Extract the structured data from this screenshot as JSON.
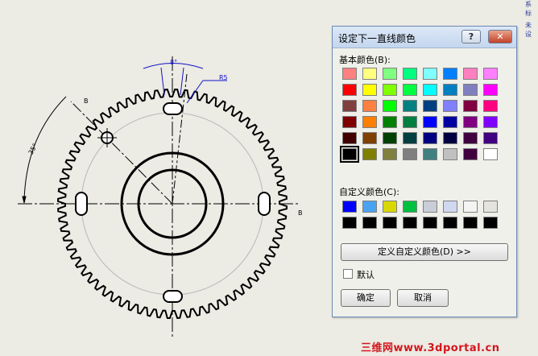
{
  "drawing": {
    "dim_top": "8°",
    "dim_left": "35°",
    "label_b_upper": "B",
    "label_b_right": "B",
    "label_r5": "R5"
  },
  "corner": {
    "line1": "系 标",
    "line2": "未 设"
  },
  "dialog": {
    "title": "设定下一直线颜色",
    "help_label": "?",
    "close_label": "✕",
    "basic_label": "基本颜色(B):",
    "custom_label": "自定义颜色(C):",
    "define_custom_label": "定义自定义颜色(D) >>",
    "default_label": "默认",
    "ok_label": "确定",
    "cancel_label": "取消",
    "default_checked": false,
    "selected_basic_index": 40,
    "basic_colors": [
      "#ff8080",
      "#ffff80",
      "#80ff80",
      "#00ff80",
      "#80ffff",
      "#0080ff",
      "#ff80c0",
      "#ff80ff",
      "#ff0000",
      "#ffff00",
      "#80ff00",
      "#00ff40",
      "#00ffff",
      "#0080c0",
      "#8080c0",
      "#ff00ff",
      "#804040",
      "#ff8040",
      "#00ff00",
      "#008080",
      "#004080",
      "#8080ff",
      "#800040",
      "#ff0080",
      "#800000",
      "#ff8000",
      "#008000",
      "#008040",
      "#0000ff",
      "#0000a0",
      "#800080",
      "#8000ff",
      "#400000",
      "#804000",
      "#004000",
      "#004040",
      "#000080",
      "#000040",
      "#400040",
      "#400080",
      "#000000",
      "#808000",
      "#808040",
      "#808080",
      "#408080",
      "#c0c0c0",
      "#400040",
      "#ffffff"
    ],
    "custom_colors": [
      "#0000ff",
      "#4aa3f0",
      "#d8d800",
      "#00c040",
      "#c8cdd8",
      "#d0d8f0",
      "#f4f4f4",
      "#e4e4dc",
      "#000000",
      "#000000",
      "#000000",
      "#000000",
      "#000000",
      "#000000",
      "#000000",
      "#000000"
    ]
  },
  "watermark": "三维网www.3dportal.cn"
}
